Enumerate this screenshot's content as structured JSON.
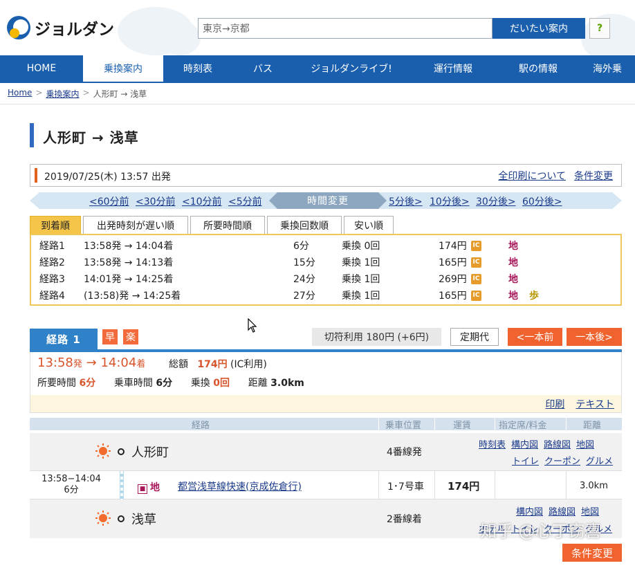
{
  "header": {
    "logo_text": "ジョルダン",
    "search_value": "東京→京都",
    "search_button": "だいたい案内",
    "help": "?"
  },
  "nav": [
    "HOME",
    "乗換案内",
    "時刻表",
    "バス",
    "ジョルダンライブ!",
    "運行情報",
    "駅の情報",
    "海外乗"
  ],
  "nav_active": 1,
  "breadcrumb": {
    "home": "Home",
    "transfer": "乗換案内",
    "current": "人形町 → 浅草",
    "sep": ">"
  },
  "page_title": "人形町 → 浅草",
  "date_bar": {
    "text": "2019/07/25(木) 13:57 出発",
    "print_link": "全印刷について",
    "cond_link": "条件変更"
  },
  "time_shift": {
    "before": [
      "<60分前",
      "<30分前",
      "<10分前",
      "<5分前"
    ],
    "center": "時間変更",
    "after": [
      "5分後>",
      "10分後>",
      "30分後>",
      "60分後>"
    ]
  },
  "sort_tabs": [
    "到着順",
    "出発時刻が遅い順",
    "所要時間順",
    "乗換回数順",
    "安い順"
  ],
  "routes": [
    {
      "label": "経路1",
      "time": "13:58発 → 14:04着",
      "duration": "6分",
      "transfers": "乗換 0回",
      "fare": "174円",
      "types": "地",
      "walk": ""
    },
    {
      "label": "経路2",
      "time": "13:58発 → 14:13着",
      "duration": "15分",
      "transfers": "乗換 1回",
      "fare": "165円",
      "types": "地",
      "walk": ""
    },
    {
      "label": "経路3",
      "time": "14:01発 → 14:25着",
      "duration": "24分",
      "transfers": "乗換 1回",
      "fare": "269円",
      "types": "地",
      "walk": ""
    },
    {
      "label": "経路4",
      "time": "(13:58)発 → 14:25着",
      "duration": "27分",
      "transfers": "乗換 1回",
      "fare": "165円",
      "types": "地",
      "walk": "歩"
    }
  ],
  "ic_label": "IC",
  "route_detail": {
    "tab": "経路 1",
    "badges": [
      "早",
      "楽"
    ],
    "fare_pill": "切符利用 180円 (+6円)",
    "teiki": "定期代",
    "prev": "<一本前",
    "next": "一本後>",
    "dep": "13:58",
    "dep_suffix": "発",
    "arrow": "→",
    "arr": "14:04",
    "arr_suffix": "着",
    "total_label": "総額",
    "total_value": "174円",
    "total_note": "(IC利用)",
    "req_label": "所要時間",
    "req_value": "6分",
    "ride_label": "乗車時間",
    "ride_value": "6分",
    "transfer_label": "乗換",
    "transfer_value": "0回",
    "distance_label": "距離",
    "distance_value": "3.0km",
    "print": "印刷",
    "text": "テキスト"
  },
  "table_headers": [
    "経路",
    "乗車位置",
    "運賃",
    "指定席/料金",
    "距離"
  ],
  "stations": [
    {
      "name": "人形町",
      "platform": "4番線発",
      "links_row1": [
        "時刻表",
        "構内図",
        "路線図",
        "地図"
      ],
      "links_row2": [
        "トイレ",
        "クーポン",
        "グルメ"
      ]
    },
    {
      "name": "浅草",
      "platform": "2番線着",
      "links_row1": [
        "構内図",
        "路線図",
        "地図"
      ],
      "links_row2": [
        "ホテル",
        "トイレ",
        "クーポン",
        "グルメ"
      ]
    }
  ],
  "segment": {
    "time": "13:58−14:04",
    "duration": "6分",
    "icon_label": "地",
    "line": "都営浅草線快速(京成佐倉行)",
    "car": "1･7号車",
    "fare": "174円",
    "distance": "3.0km"
  },
  "watermark": "知乎 @心丁窃喜",
  "float_button": "条件変更",
  "colors": {
    "primary": "#1a5fae",
    "accent": "#f0632e",
    "highlight": "#f5c54a"
  }
}
